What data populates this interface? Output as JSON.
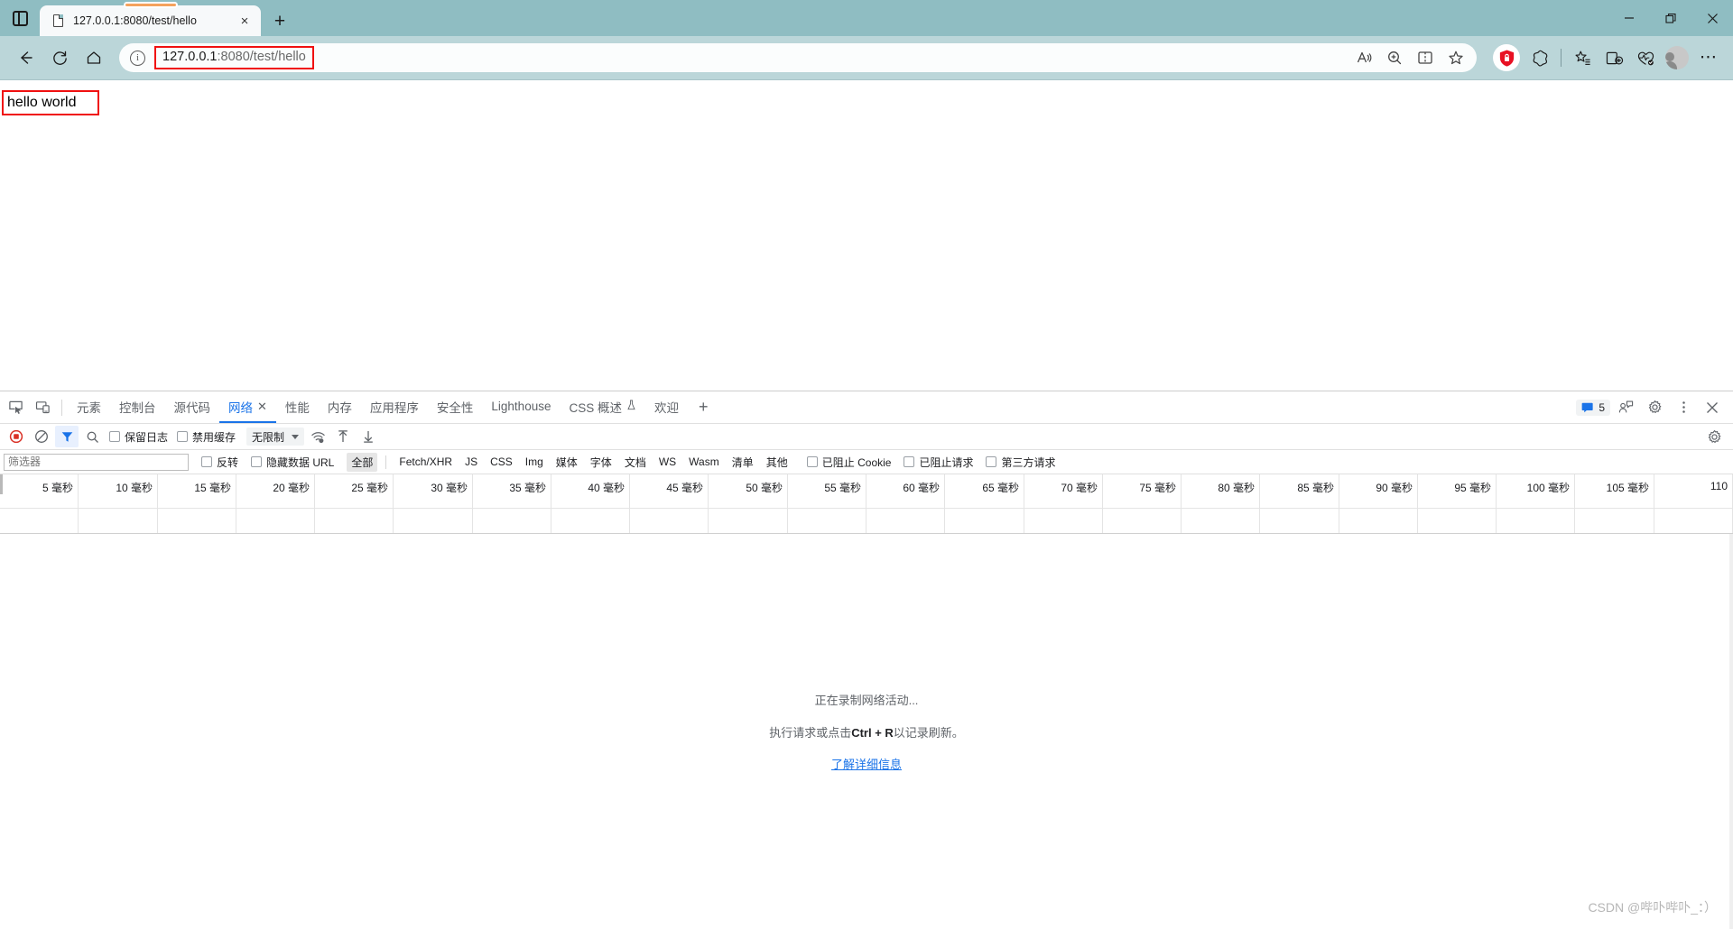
{
  "window": {
    "controls": {
      "minimize": "minimize-icon",
      "restore": "restore-icon",
      "close": "close-icon"
    },
    "vertical_tabs_label": "vertical-tabs-icon"
  },
  "tabs": [
    {
      "title": "127.0.0.1:8080/test/hello",
      "favicon": "document-icon",
      "loading": true,
      "close": "×"
    }
  ],
  "newtab_label": "+",
  "navigation": {
    "back": "←",
    "refresh": "↻",
    "home": "⌂",
    "url_full": "127.0.0.1:8080/test/hello",
    "url_host": "127.0.0.1",
    "url_path": ":8080/test/hello",
    "annotation_color": "#f01010",
    "right_icons": [
      "read-aloud-icon",
      "zoom-icon",
      "split-screen-icon",
      "favorite-star-icon"
    ],
    "toolbar_icons": [
      "security-shield-icon",
      "copilot-icon",
      "collections-icon",
      "split-tab-icon",
      "performance-icon",
      "profile-avatar",
      "settings-more-icon"
    ]
  },
  "page": {
    "body_text": "hello world",
    "annotation_color": "#f01010"
  },
  "devtools": {
    "left_icons": [
      "inspect-element-icon",
      "device-toolbar-icon"
    ],
    "tabs": [
      {
        "label": "元素",
        "active": false
      },
      {
        "label": "控制台",
        "active": false
      },
      {
        "label": "源代码",
        "active": false
      },
      {
        "label": "网络",
        "active": true,
        "closeable": true
      },
      {
        "label": "性能",
        "active": false
      },
      {
        "label": "内存",
        "active": false
      },
      {
        "label": "应用程序",
        "active": false
      },
      {
        "label": "安全性",
        "active": false
      },
      {
        "label": "Lighthouse",
        "active": false
      },
      {
        "label": "CSS 概述",
        "active": false,
        "beta": true
      },
      {
        "label": "欢迎",
        "active": false
      }
    ],
    "add_tab": "+",
    "tabbar_right": {
      "message_count": "5",
      "message_icon": "message-badge-icon",
      "feedback_icon": "feedback-icon",
      "settings_icon": "gear-icon",
      "more_icon": "kebab-menu-icon",
      "close_icon": "close-devtools-icon"
    },
    "toolbar": {
      "record_icon": "record-stop-icon",
      "clear_icon": "clear-icon",
      "filter_icon": "filter-funnel-icon",
      "search_icon": "search-icon",
      "preserve_log_label": "保留日志",
      "preserve_log_checked": false,
      "disable_cache_label": "禁用缓存",
      "disable_cache_checked": false,
      "throttle_value": "无限制",
      "wifi_icon": "network-conditions-icon",
      "import_icon": "import-har-icon",
      "export_icon": "export-har-icon",
      "settings_icon": "gear-icon"
    },
    "filterbar": {
      "filter_placeholder": "筛选器",
      "filter_value": "",
      "invert_label": "反转",
      "invert_checked": false,
      "hide_data_urls_label": "隐藏数据 URL",
      "hide_data_urls_checked": false,
      "types": [
        {
          "label": "全部",
          "selected": true
        },
        {
          "label": "Fetch/XHR",
          "selected": false
        },
        {
          "label": "JS",
          "selected": false
        },
        {
          "label": "CSS",
          "selected": false
        },
        {
          "label": "Img",
          "selected": false
        },
        {
          "label": "媒体",
          "selected": false
        },
        {
          "label": "字体",
          "selected": false
        },
        {
          "label": "文档",
          "selected": false
        },
        {
          "label": "WS",
          "selected": false
        },
        {
          "label": "Wasm",
          "selected": false
        },
        {
          "label": "清单",
          "selected": false
        },
        {
          "label": "其他",
          "selected": false
        }
      ],
      "blocked_cookies_label": "已阻止 Cookie",
      "blocked_cookies_checked": false,
      "blocked_requests_label": "已阻止请求",
      "blocked_requests_checked": false,
      "third_party_label": "第三方请求",
      "third_party_checked": false
    },
    "timeline": {
      "unit": "毫秒",
      "ticks": [
        {
          "value": 5,
          "label": "5 毫秒"
        },
        {
          "value": 10,
          "label": "10 毫秒"
        },
        {
          "value": 15,
          "label": "15 毫秒"
        },
        {
          "value": 20,
          "label": "20 毫秒"
        },
        {
          "value": 25,
          "label": "25 毫秒"
        },
        {
          "value": 30,
          "label": "30 毫秒"
        },
        {
          "value": 35,
          "label": "35 毫秒"
        },
        {
          "value": 40,
          "label": "40 毫秒"
        },
        {
          "value": 45,
          "label": "45 毫秒"
        },
        {
          "value": 50,
          "label": "50 毫秒"
        },
        {
          "value": 55,
          "label": "55 毫秒"
        },
        {
          "value": 60,
          "label": "60 毫秒"
        },
        {
          "value": 65,
          "label": "65 毫秒"
        },
        {
          "value": 70,
          "label": "70 毫秒"
        },
        {
          "value": 75,
          "label": "75 毫秒"
        },
        {
          "value": 80,
          "label": "80 毫秒"
        },
        {
          "value": 85,
          "label": "85 毫秒"
        },
        {
          "value": 90,
          "label": "90 毫秒"
        },
        {
          "value": 95,
          "label": "95 毫秒"
        },
        {
          "value": 100,
          "label": "100 毫秒"
        },
        {
          "value": 105,
          "label": "105 毫秒"
        },
        {
          "value": 110,
          "label": "110"
        }
      ]
    },
    "empty_state": {
      "line1": "正在录制网络活动...",
      "line2_pre": "执行请求或点击",
      "line2_bold": "Ctrl + R",
      "line2_post": "以记录刷新。",
      "learn_more": "了解详细信息"
    }
  },
  "watermark": "CSDN @哔卟哔卟_：）"
}
